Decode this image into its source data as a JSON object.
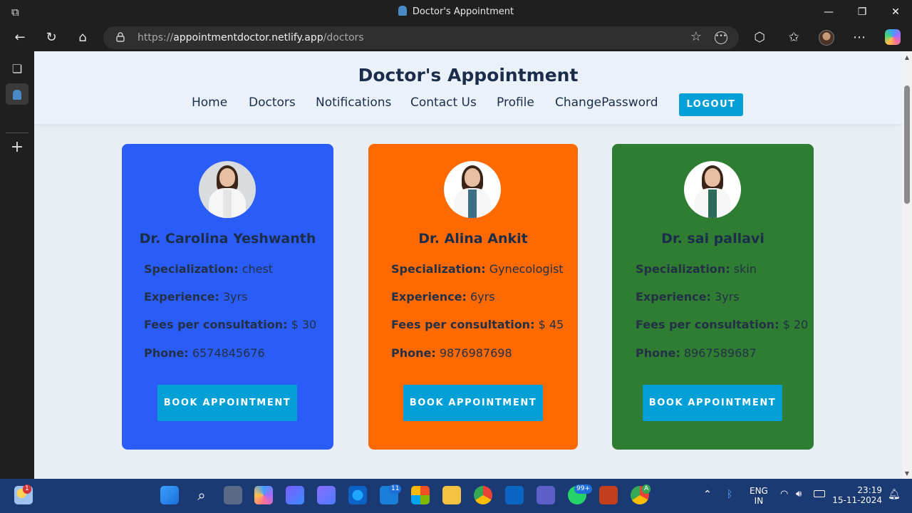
{
  "browser": {
    "tab_title": "Doctor's Appointment",
    "url_prefix": "https://",
    "url_host": "appointmentdoctor.netlify.app",
    "url_path": "/doctors"
  },
  "site": {
    "title": "Doctor's Appointment",
    "nav": [
      "Home",
      "Doctors",
      "Notifications",
      "Contact Us",
      "Profile",
      "ChangePassword"
    ],
    "logout_label": "LOGOUT"
  },
  "labels": {
    "specialization": "Specialization:",
    "experience": "Experience:",
    "fees": "Fees per consultation:",
    "phone": "Phone:",
    "book": "BOOK APPOINTMENT"
  },
  "doctors": [
    {
      "name": "Dr. Carolina Yeshwanth",
      "specialization": "chest",
      "experience": "3yrs",
      "fees": "$ 30",
      "phone": "6574845676",
      "card_color": "#2a5df7"
    },
    {
      "name": "Dr. Alina Ankit",
      "specialization": "Gynecologist",
      "experience": "6yrs",
      "fees": "$ 45",
      "phone": "9876987698",
      "card_color": "#ff6a00"
    },
    {
      "name": "Dr. sai pallavi",
      "specialization": "skin",
      "experience": "3yrs",
      "fees": "$ 20",
      "phone": "8967589687",
      "card_color": "#2e7d32"
    }
  ],
  "taskbar": {
    "weather_badge": "1",
    "mail_badge": "11",
    "whatsapp_badge": "99+",
    "chrome_badge": "A",
    "lang_line1": "ENG",
    "lang_line2": "IN",
    "time": "23:19",
    "date": "15-11-2024"
  },
  "colors": {
    "accent": "#02a0d7",
    "heading": "#1b2d4a"
  }
}
